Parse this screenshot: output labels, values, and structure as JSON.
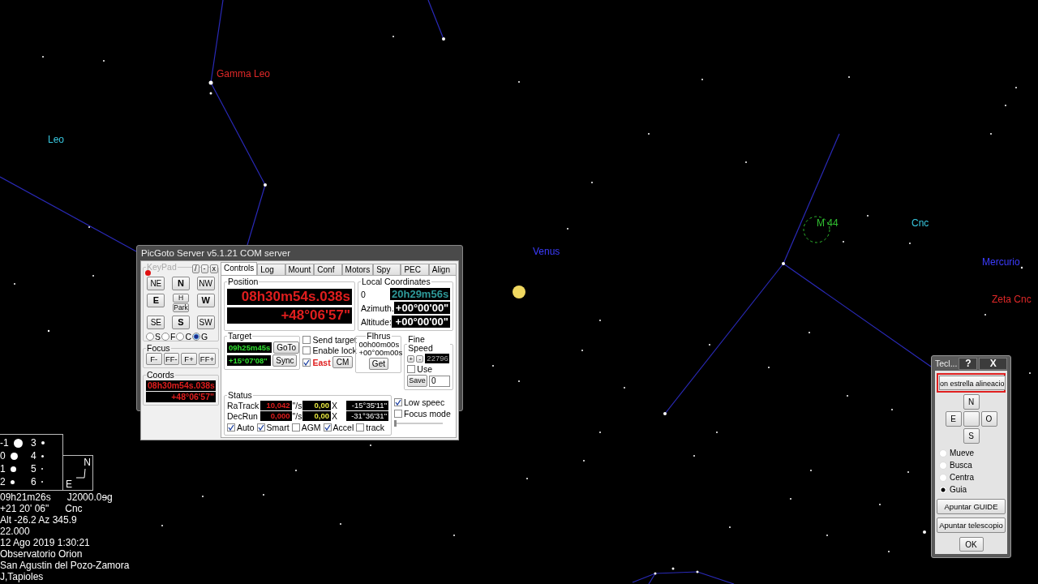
{
  "sky_labels": [
    {
      "text": "Gamma Leo",
      "color": "#e02828"
    },
    {
      "text": "Leo",
      "color": "#38c8e0"
    },
    {
      "text": "Venus",
      "color": "#3c3cff"
    },
    {
      "text": "M 44",
      "color": "#30c030"
    },
    {
      "text": "Cnc",
      "color": "#38c8e0"
    },
    {
      "text": "Mercurio",
      "color": "#3c3cff"
    },
    {
      "text": "Zeta Cnc",
      "color": "#e02828"
    }
  ],
  "magnitude_legend": [
    "-1",
    "0",
    "1",
    "2",
    "3",
    "4",
    "5",
    "6"
  ],
  "compass": {
    "north": "N",
    "east": "E"
  },
  "info_rows": [
    [
      "09h21m26s",
      "J2000.0ɘg"
    ],
    [
      "+21 20' 06\"",
      "Cnc"
    ],
    [
      "Alt -26.2  Az 345.9"
    ],
    [
      "22.000"
    ],
    [
      "12 Ago 2019  1:30:21"
    ],
    [
      "Observatorio Orion"
    ],
    [
      "San Agustin del Pozo-Zamora"
    ],
    [
      "J,Tapioles"
    ]
  ],
  "picgoto": {
    "title": "PicGoto Server  v5.1.21 COM server",
    "keypad": {
      "legend": "KeyPad",
      "window_buttons": [
        "/",
        "-",
        "x"
      ],
      "led_on": true,
      "keys": [
        {
          "kind": "key",
          "label": "NE",
          "bold": false
        },
        {
          "kind": "key",
          "label": "N",
          "bold": true
        },
        {
          "kind": "key",
          "label": "NW",
          "bold": false
        },
        {
          "kind": "key",
          "label": "E",
          "bold": true
        },
        {
          "kind": "stack",
          "labels": [
            "H",
            "Park"
          ]
        },
        {
          "kind": "key",
          "label": "W",
          "bold": true
        },
        {
          "kind": "key",
          "label": "SE",
          "bold": false
        },
        {
          "kind": "key",
          "label": "S",
          "bold": true
        },
        {
          "kind": "key",
          "label": "SW",
          "bold": false
        }
      ],
      "modes": [
        {
          "label": "S",
          "selected": false
        },
        {
          "label": "F",
          "selected": false
        },
        {
          "label": "C",
          "selected": false
        },
        {
          "label": "G",
          "selected": true
        }
      ]
    },
    "focus": {
      "legend": "Focus",
      "buttons": [
        "F-",
        "FF-",
        "F+",
        "FF+"
      ]
    },
    "coords": {
      "legend": "Coords",
      "ra": "08h30m54s.038s",
      "dec": "+48°06'57\""
    },
    "tabs": [
      {
        "label": "Controls",
        "selected": true
      },
      {
        "label": "Log",
        "selected": false
      },
      {
        "label": "Mount",
        "selected": false
      },
      {
        "label": "Conf",
        "selected": false
      },
      {
        "label": "Motors",
        "selected": false
      },
      {
        "label": "Spy",
        "selected": false
      },
      {
        "label": "PEC",
        "selected": false
      },
      {
        "label": "Align",
        "selected": false
      }
    ],
    "position": {
      "legend": "Position",
      "ra": "08h30m54s.038s",
      "dec": "+48°06'57\""
    },
    "local_coordinates": {
      "legend": "Local Coordinates",
      "rows": [
        {
          "label": "0",
          "value": "20h29m56s",
          "kind": "time"
        },
        {
          "label": "Azimuth.",
          "value": "+00°00'00\"",
          "kind": "angle"
        },
        {
          "label": "Altitude:",
          "value": "+00°00'00\"",
          "kind": "angle"
        }
      ]
    },
    "target": {
      "legend": "Target",
      "ra": "09h25m45s",
      "dec": "+15°07'08\"",
      "buttons": [
        "GoTo",
        "Sync"
      ]
    },
    "options": [
      {
        "label": "Send target",
        "checked": false,
        "warning": false
      },
      {
        "label": "Enable lock",
        "checked": false,
        "warning": false
      },
      {
        "label": "East",
        "checked": true,
        "warning": true
      }
    ],
    "cm_button": "CM",
    "flhrus": {
      "legend": "Flhrus",
      "lines": [
        "00h00m00s",
        "+00°00m00s"
      ],
      "button": "Get"
    },
    "fine_speed": {
      "legend": "Fine Speed",
      "buttons": [
        "+",
        "-"
      ],
      "value": "22796",
      "use": {
        "label": "Use",
        "checked": false
      },
      "save": "Save",
      "input": "0"
    },
    "status": {
      "legend": "Status",
      "rows": [
        {
          "label": "RaTrack",
          "rate": "10,042",
          "unit": "\"/s",
          "factor": "0,00",
          "factor_unit": "X",
          "angle": "-15°35'11\""
        },
        {
          "label": "DecRun",
          "rate": "0,000",
          "unit": "\"/s",
          "factor": "0,00",
          "factor_unit": "X",
          "angle": "-31°36'31\""
        }
      ],
      "checks": [
        {
          "label": "Auto",
          "checked": true
        },
        {
          "label": "Smart",
          "checked": true
        },
        {
          "label": "AGM",
          "checked": false
        },
        {
          "label": "Accel",
          "checked": true
        },
        {
          "label": "track",
          "checked": false
        }
      ]
    },
    "side_checks": [
      {
        "label": "Low speec",
        "checked": true
      },
      {
        "label": "Focus mode",
        "checked": false
      }
    ],
    "slider": {
      "level": 0
    }
  },
  "hand_pad": {
    "title": "Tecl...",
    "title_buttons": [
      "?",
      "X"
    ],
    "field": {
      "value": "on estrella alineacio",
      "highlighted": true
    },
    "directions": [
      "N",
      "E",
      "O",
      "S"
    ],
    "modes": [
      {
        "label": "Mueve",
        "selected": false
      },
      {
        "label": "Busca",
        "selected": false
      },
      {
        "label": "Centra",
        "selected": false
      },
      {
        "label": "Guia",
        "selected": true
      }
    ],
    "buttons": [
      "Apuntar GUIDE",
      "Apuntar telescopio"
    ],
    "ok": "OK"
  }
}
